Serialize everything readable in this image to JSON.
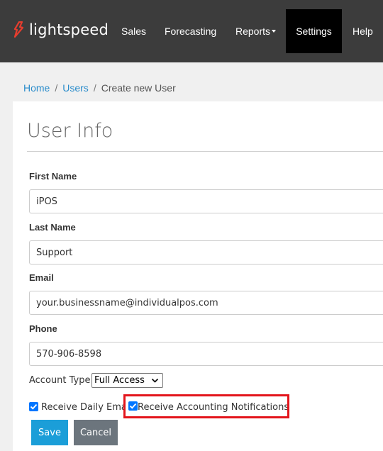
{
  "brand": {
    "name": "lightspeed",
    "logo_color": "#e63d2e"
  },
  "nav": {
    "items": [
      {
        "label": "Sales"
      },
      {
        "label": "Forecasting"
      },
      {
        "label": "Reports"
      },
      {
        "label": "Settings",
        "active": true
      },
      {
        "label": "Help"
      }
    ]
  },
  "breadcrumb": {
    "home": "Home",
    "users": "Users",
    "current": "Create new User",
    "separator": "/"
  },
  "page": {
    "title": "User Info"
  },
  "form": {
    "first_name": {
      "label": "First Name",
      "value": "iPOS"
    },
    "last_name": {
      "label": "Last Name",
      "value": "Support"
    },
    "email": {
      "label": "Email",
      "value": "your.businessname@individualpos.com"
    },
    "phone": {
      "label": "Phone",
      "value": "570-906-8598"
    },
    "account_type": {
      "label": "Account Type",
      "selected": "Full Access"
    },
    "daily_email": {
      "label": "Receive Daily Email",
      "checked": true
    },
    "accounting_notifications": {
      "label": "Receive Accounting Notifications",
      "checked": true,
      "highlight_color": "#e3151c"
    }
  },
  "buttons": {
    "save": "Save",
    "cancel": "Cancel"
  },
  "colors": {
    "topbar": "#3c3c3c",
    "active_nav": "#000000",
    "link": "#2a8ccb",
    "save": "#1b9ed8",
    "cancel": "#6c757d",
    "checkbox": "#0075ff"
  }
}
